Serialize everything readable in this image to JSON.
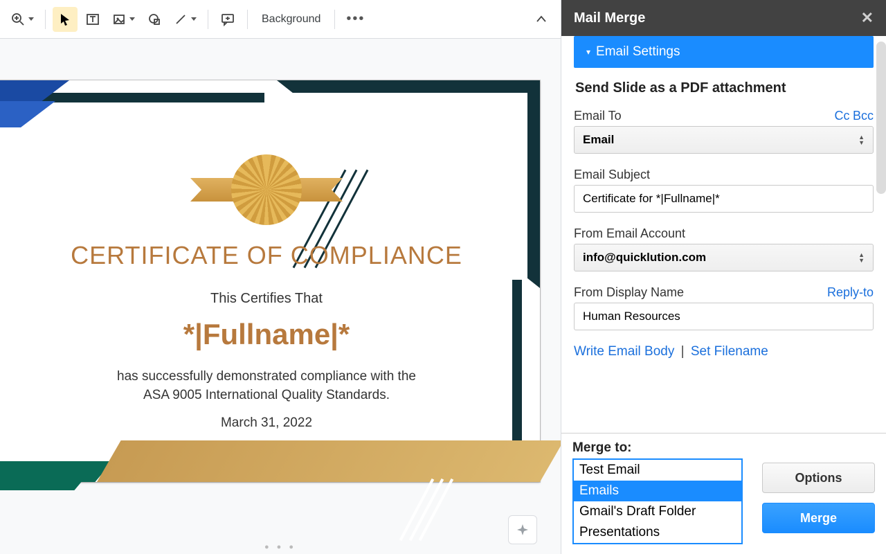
{
  "toolbar": {
    "background_label": "Background"
  },
  "certificate": {
    "title": "CERTIFICATE OF COMPLIANCE",
    "certifies": "This Certifies That",
    "fullname": "*|Fullname|*",
    "line1": "has successfully demonstrated compliance with the",
    "line2": "ASA 9005 International Quality Standards.",
    "date": "March 31, 2022"
  },
  "panel": {
    "title": "Mail Merge",
    "accordion": "Email Settings",
    "heading": "Send Slide as a PDF attachment",
    "email_to_label": "Email To",
    "cc_label": "Cc",
    "bcc_label": "Bcc",
    "email_to_value": "Email",
    "subject_label": "Email Subject",
    "subject_value": "Certificate for *|Fullname|*",
    "from_account_label": "From Email Account",
    "from_account_value": "info@quicklution.com",
    "display_name_label": "From Display Name",
    "replyto_label": "Reply-to",
    "display_name_value": "Human Resources",
    "write_body": "Write Email Body",
    "set_filename": "Set Filename",
    "footer_label": "Merge to:",
    "options": [
      "Test Email",
      "Emails",
      "Gmail's Draft Folder",
      "Presentations"
    ],
    "selected_option": 1,
    "options_btn": "Options",
    "merge_btn": "Merge"
  }
}
